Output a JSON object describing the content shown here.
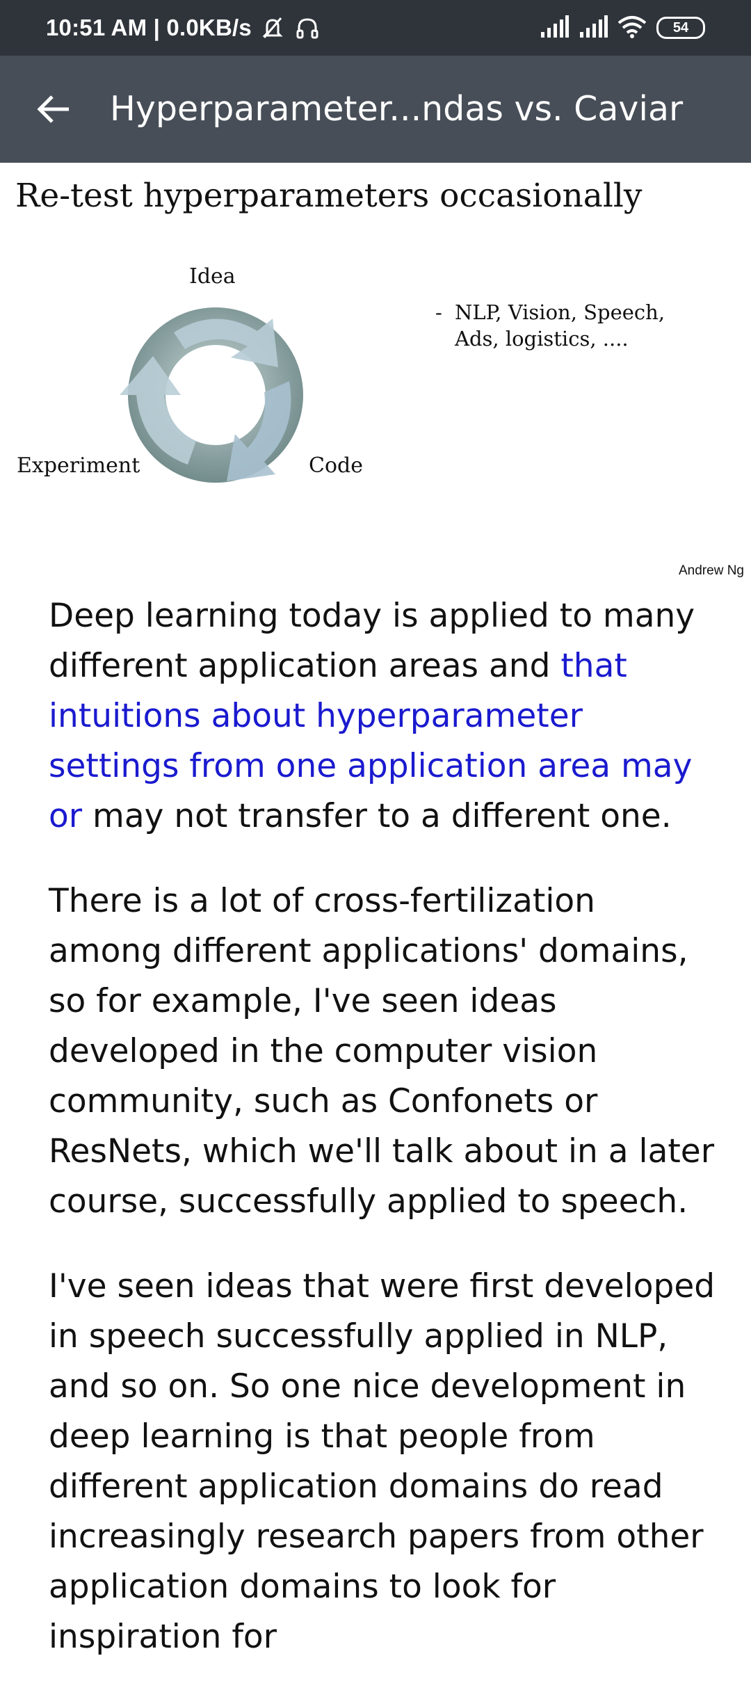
{
  "status_bar": {
    "time_speed": "10:51 AM | 0.0KB/s",
    "battery": "54"
  },
  "app_bar": {
    "title": "Hyperparameter...ndas vs. Caviar"
  },
  "slide": {
    "title": "Re-test hyperparameters occasionally",
    "cycle_labels": {
      "top": "Idea",
      "left": "Experiment",
      "right": "Code"
    },
    "bullet_dash": "-",
    "bullet_text": "NLP, Vision, Speech, Ads, logistics, ....",
    "credit": "Andrew Ng"
  },
  "article": {
    "p1_a": "Deep learning today is applied to many different application areas and ",
    "p1_highlight": "that intuitions about hyperparameter settings from one application area may or",
    "p1_b": " may not transfer to a different one.",
    "p2": "There is a lot of cross-fertilization among different applications' domains, so for example, I've seen ideas developed in the computer vision community, such as Confonets or ResNets, which we'll talk about in a later course, successfully applied to speech.",
    "p3": "I've seen ideas that were first developed in speech successfully applied in NLP, and so on. So one nice development in deep learning is that people from different application domains do read increasingly research papers from other application domains to look for inspiration for"
  }
}
